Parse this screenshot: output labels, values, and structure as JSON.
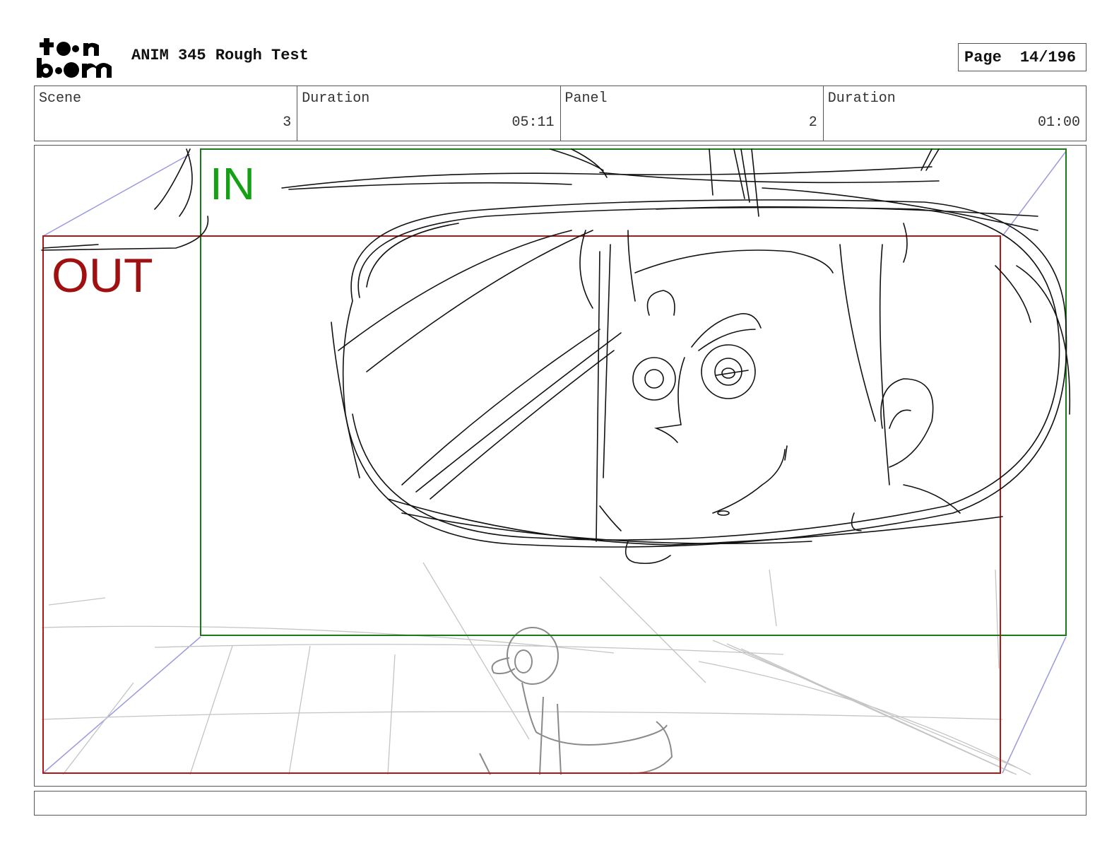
{
  "header": {
    "logo_text": "toon boom",
    "project_title": "ANIM 345 Rough Test",
    "page_label": "Page",
    "page_value": "14/196"
  },
  "info": {
    "scene_label": "Scene",
    "scene_value": "3",
    "scene_duration_label": "Duration",
    "scene_duration_value": "05:11",
    "panel_label": "Panel",
    "panel_value": "2",
    "panel_duration_label": "Duration",
    "panel_duration_value": "01:00"
  },
  "panel": {
    "in_label": "IN",
    "out_label": "OUT",
    "in_color": "#1a8a1a",
    "out_color": "#a01010",
    "perspective_color": "#9a9ae0"
  },
  "notes": {
    "text": ""
  }
}
